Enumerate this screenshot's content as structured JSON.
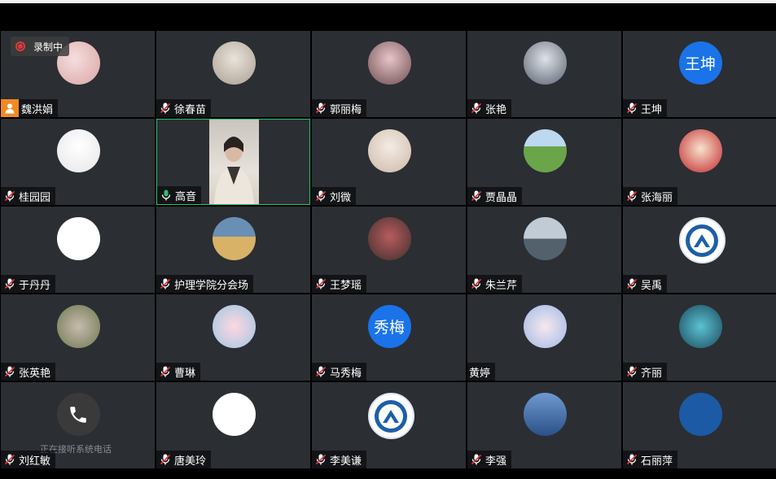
{
  "recording": {
    "label": "录制中"
  },
  "colors": {
    "accent_blue": "#1a73e8",
    "active_border": "#2fc06b",
    "recording_red": "#e0393e",
    "host_orange": "#f08a24"
  },
  "participants": [
    {
      "name": "魏洪娟",
      "mic": "host",
      "avatar": "photo"
    },
    {
      "name": "徐春苗",
      "mic": "muted",
      "avatar": "photo"
    },
    {
      "name": "郭丽梅",
      "mic": "muted",
      "avatar": "photo"
    },
    {
      "name": "张艳",
      "mic": "muted",
      "avatar": "photo"
    },
    {
      "name": "王坤",
      "mic": "muted",
      "avatar": "text",
      "avatar_text": "王坤"
    },
    {
      "name": "桂园园",
      "mic": "muted",
      "avatar": "photo"
    },
    {
      "name": "高音",
      "mic": "active",
      "avatar": "video"
    },
    {
      "name": "刘微",
      "mic": "muted",
      "avatar": "photo"
    },
    {
      "name": "贾晶晶",
      "mic": "muted",
      "avatar": "photo"
    },
    {
      "name": "张海丽",
      "mic": "muted",
      "avatar": "photo"
    },
    {
      "name": "于丹丹",
      "mic": "muted",
      "avatar": "photo"
    },
    {
      "name": "护理学院分会场",
      "mic": "muted",
      "avatar": "photo"
    },
    {
      "name": "王梦瑶",
      "mic": "muted",
      "avatar": "photo"
    },
    {
      "name": "朱兰芹",
      "mic": "muted",
      "avatar": "photo"
    },
    {
      "name": "吴禹",
      "mic": "muted",
      "avatar": "logo"
    },
    {
      "name": "张英艳",
      "mic": "muted",
      "avatar": "photo"
    },
    {
      "name": "曹琳",
      "mic": "muted",
      "avatar": "photo"
    },
    {
      "name": "马秀梅",
      "mic": "muted",
      "avatar": "text",
      "avatar_text": "秀梅"
    },
    {
      "name": "黄婷",
      "mic": "none",
      "avatar": "photo"
    },
    {
      "name": "齐丽",
      "mic": "muted",
      "avatar": "photo"
    },
    {
      "name": "刘红敏",
      "mic": "muted",
      "avatar": "phone",
      "status": "正在接听系统电话"
    },
    {
      "name": "唐美玲",
      "mic": "muted",
      "avatar": "photo"
    },
    {
      "name": "李美谦",
      "mic": "muted",
      "avatar": "logo"
    },
    {
      "name": "李强",
      "mic": "muted",
      "avatar": "photo"
    },
    {
      "name": "石丽萍",
      "mic": "muted",
      "avatar": "photo"
    }
  ]
}
